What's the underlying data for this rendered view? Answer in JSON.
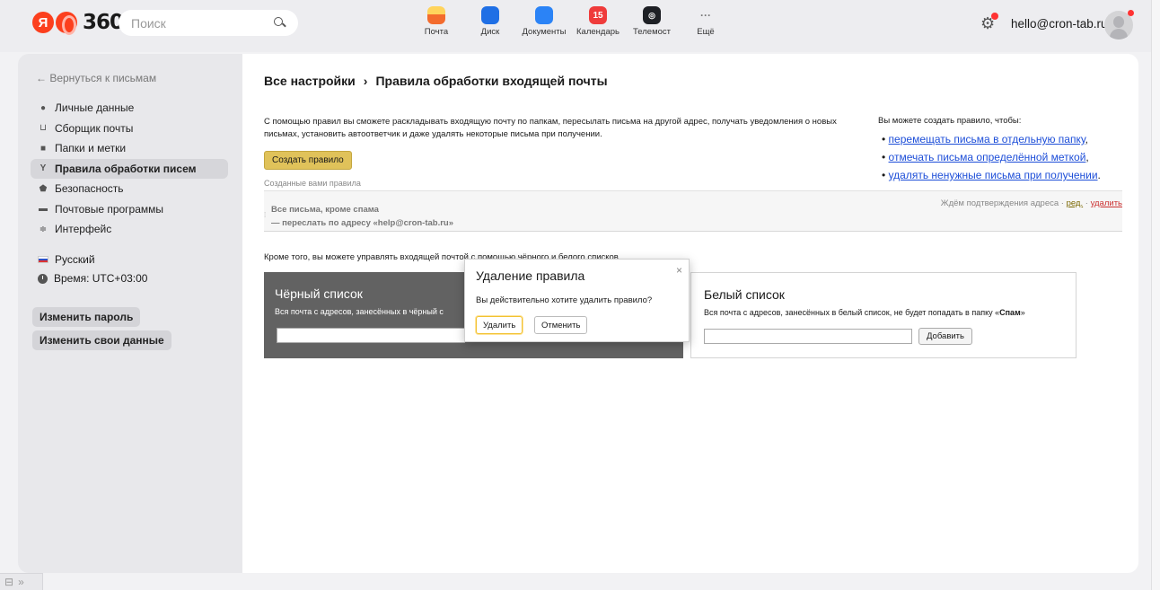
{
  "header": {
    "logo_text": "360",
    "logo_letter": "Я",
    "search_placeholder": "Поиск",
    "apps": [
      {
        "label": "Почта",
        "icon": "mail-icon",
        "badge": ""
      },
      {
        "label": "Диск",
        "icon": "disk-icon",
        "badge": ""
      },
      {
        "label": "Документы",
        "icon": "documents-icon",
        "badge": ""
      },
      {
        "label": "Календарь",
        "icon": "calendar-icon",
        "badge": "15"
      },
      {
        "label": "Телемост",
        "icon": "telemost-icon",
        "badge": ""
      },
      {
        "label": "Ещё",
        "icon": "more-icon",
        "badge": "···"
      }
    ],
    "email": "hello@cron-tab.ru"
  },
  "sidebar": {
    "back_label": "← Вернуться к письмам",
    "items": [
      {
        "label": "Личные данные",
        "icon": "person-icon",
        "active": false
      },
      {
        "label": "Сборщик почты",
        "icon": "inbox-icon",
        "active": false
      },
      {
        "label": "Папки и метки",
        "icon": "folder-icon",
        "active": false
      },
      {
        "label": "Правила обработки писем",
        "icon": "rules-icon",
        "active": true
      },
      {
        "label": "Безопасность",
        "icon": "shield-icon",
        "active": false
      },
      {
        "label": "Почтовые программы",
        "icon": "monitor-icon",
        "active": false
      },
      {
        "label": "Интерфейс",
        "icon": "sliders-icon",
        "active": false
      }
    ],
    "language": "Русский",
    "timezone": "Время: UTC+03:00",
    "change_password": "Изменить пароль",
    "change_data": "Изменить свои данные"
  },
  "main": {
    "breadcrumb_root": "Все настройки",
    "breadcrumb_sep": "›",
    "breadcrumb_current": "Правила обработки входящей почты",
    "description": "С помощью правил вы сможете раскладывать входящую почту по папкам, пересылать письма на другой адрес, получать уведомления о новых письмах, установить автоответчик и даже удалять некоторые письма при получении.",
    "create_button": "Создать правило",
    "created_label": "Созданные вами правила",
    "rule": {
      "condition": "Все письма, кроме спама",
      "action": "— переслать по адресу «help@cron-tab.ru»",
      "status": "Ждём подтверждения адреса · ",
      "edit": "ред.",
      "sep": " · ",
      "delete": "удалить"
    },
    "tips_title": "Вы можете создать правило, чтобы:",
    "tips": [
      "перемещать письма в отдельную папку",
      "отмечать письма определённой меткой",
      "удалять ненужные письма при получении"
    ],
    "tips_suffix": [
      ",",
      ",",
      "."
    ],
    "also_text": "Кроме того, вы можете управлять входящей почтой с помощью чёрного и белого списков.",
    "blacklist_title": "Чёрный список",
    "blacklist_desc": "Вся почта с адресов, занесённых в чёрный с",
    "whitelist_title": "Белый список",
    "whitelist_desc_pre": "Вся почта с адресов, занесённых в белый список, не будет попадать в папку «",
    "whitelist_desc_bold": "Спам",
    "whitelist_desc_post": "»",
    "whitelist_add": "Добавить"
  },
  "modal": {
    "title": "Удаление правила",
    "close": "×",
    "text": "Вы действительно хотите удалить правило?",
    "confirm": "Удалить",
    "cancel": "Отменить"
  },
  "bottom": {
    "icon": "ꟷ",
    "expand": "»"
  }
}
